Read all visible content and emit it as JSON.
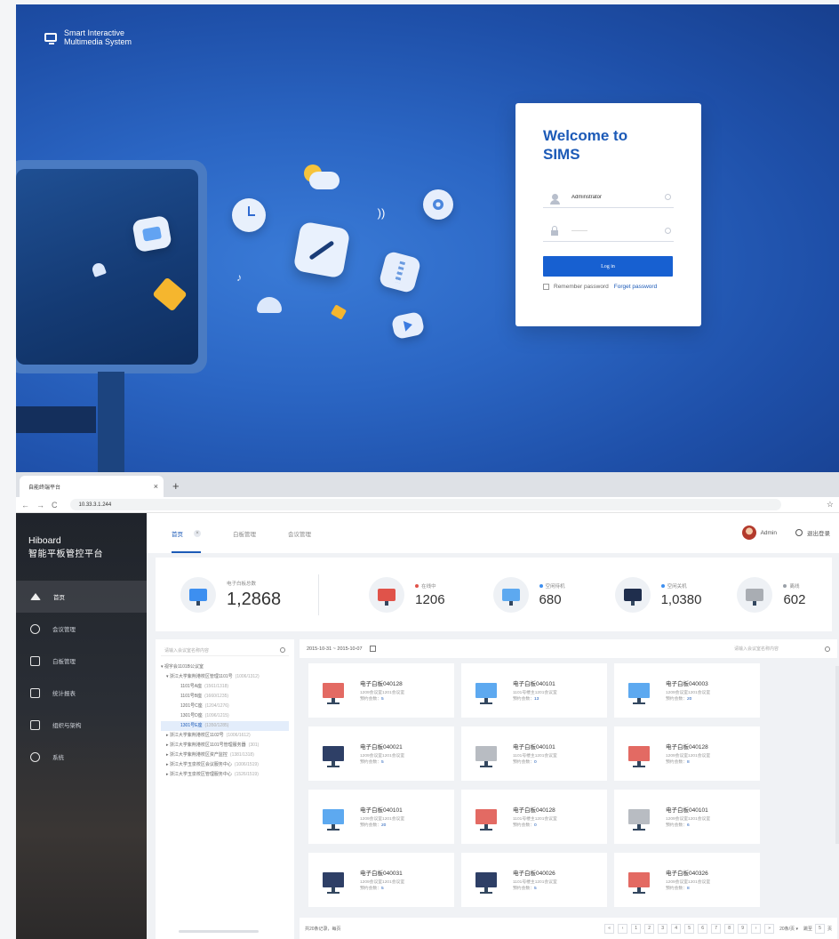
{
  "login": {
    "brand_line1": "Smart Interactive",
    "brand_line2": "Multimedia System",
    "welcome_line1": "Welcome to",
    "welcome_line2": "SIMS",
    "username_value": "Adminstrator",
    "password_value": "·········",
    "login_button": "Log in",
    "remember_label": "Remember password",
    "forget_label": "Forget password",
    "colors": {
      "accent": "#1760d1",
      "title": "#1c5ab7",
      "bg": "#2b66c4"
    }
  },
  "browser": {
    "tab_title": "自能终端平台",
    "tab_close": "×",
    "new_tab": "+",
    "back": "←",
    "forward": "→",
    "reload": "C",
    "url": "10.33.3.1.244",
    "star": "☆"
  },
  "app": {
    "brand_line1": "Hiboard",
    "brand_line2": "智能平板管控平台",
    "nav": [
      {
        "label": "首页",
        "icon": "home-icon"
      },
      {
        "label": "会议管理",
        "icon": "people-icon"
      },
      {
        "label": "白板管理",
        "icon": "monitor-icon"
      },
      {
        "label": "统计报表",
        "icon": "chart-icon"
      },
      {
        "label": "组织与架构",
        "icon": "send-icon"
      },
      {
        "label": "系统",
        "icon": "settings-icon"
      }
    ],
    "top_tabs": [
      {
        "label": "首页",
        "close": "×"
      },
      {
        "label": "白板管理"
      },
      {
        "label": "会议管理"
      }
    ],
    "user_name": "Admin",
    "logout_label": "退出登录",
    "stats": {
      "total_label": "电子白板总数",
      "total_value": "1,2868",
      "items": [
        {
          "label": "在线中",
          "value": "1206",
          "color": "#e0534a"
        },
        {
          "label": "空闲待机",
          "value": "680",
          "color": "#3d8ff0"
        },
        {
          "label": "空闲关机",
          "value": "1,0380",
          "color": "#3d8ff0"
        },
        {
          "label": "离线",
          "value": "602",
          "color": "#9aa0a8"
        }
      ]
    },
    "tree": {
      "search_placeholder": "请输入会议室名称内容",
      "nodes": [
        {
          "text": "▾ 视字会1101B公议室",
          "count": "",
          "level": "l1"
        },
        {
          "text": "▾ 浙江大学紫荆港校区管理1101号",
          "count": "(1006/1312)",
          "level": "l2"
        },
        {
          "text": "1101号A座",
          "count": "(1561/1318)",
          "level": "l3"
        },
        {
          "text": "1101号B座",
          "count": "(1660/1235)",
          "level": "l3"
        },
        {
          "text": "1201号C座",
          "count": "(1204/1276)",
          "level": "l3"
        },
        {
          "text": "1301号D座",
          "count": "(1096/1215)",
          "level": "l3"
        },
        {
          "text": "1301号E座",
          "count": "(1350/1285)",
          "level": "l3"
        },
        {
          "text": "▸ 浙江大学紫荆港校区1102号",
          "count": "(1006/1612)",
          "level": "l2"
        },
        {
          "text": "▸ 浙江大学紫荆港校区1101号管理服务器",
          "count": "(301)",
          "level": "l2"
        },
        {
          "text": "▸ 浙江大学紫荆港校区资产监控",
          "count": "(1381/1318)",
          "level": "l2"
        },
        {
          "text": "▸ 浙江大学玉泉校区会议服务中心",
          "count": "(1006/1519)",
          "level": "l2"
        },
        {
          "text": "▸ 浙江大学玉泉校区管理服务中心",
          "count": "(1526/1519)",
          "level": "l2"
        }
      ]
    },
    "grid": {
      "date_range": "2015-10-31 ~ 2015-10-07",
      "search_placeholder": "请输入会议室名称内容",
      "cards": [
        {
          "name": "电子白板040128",
          "line1": "1209会议室1201会议室",
          "line2": "预约会数：",
          "count": "5",
          "color": "#e36a63"
        },
        {
          "name": "电子白板040101",
          "line1": "1101号楼主1201会议室",
          "line2": "预约会数：",
          "count": "13",
          "color": "#5da9f0"
        },
        {
          "name": "电子白板040003",
          "line1": "1209会议室1201会议室",
          "line2": "预约会数：",
          "count": "20",
          "color": "#5da9f0"
        },
        {
          "name": "电子白板040021",
          "line1": "1209会议室1201会议室",
          "line2": "预约会数：",
          "count": "5",
          "color": "#2e3f66"
        },
        {
          "name": "电子白板040101",
          "line1": "1101号楼主1201会议室",
          "line2": "预约会数：",
          "count": "0",
          "color": "#b8bcc2"
        },
        {
          "name": "电子白板040128",
          "line1": "1209会议室1201会议室",
          "line2": "预约会数：",
          "count": "8",
          "color": "#e36a63"
        },
        {
          "name": "电子白板040101",
          "line1": "1209会议室1201会议室",
          "line2": "预约会数：",
          "count": "20",
          "color": "#5da9f0"
        },
        {
          "name": "电子白板040128",
          "line1": "1101号楼主1201会议室",
          "line2": "预约会数：",
          "count": "0",
          "color": "#e36a63"
        },
        {
          "name": "电子白板040101",
          "line1": "1209会议室1201会议室",
          "line2": "预约会数：",
          "count": "6",
          "color": "#b8bcc2"
        },
        {
          "name": "电子白板040031",
          "line1": "1209会议室1201会议室",
          "line2": "预约会数：",
          "count": "5",
          "color": "#2e3f66"
        },
        {
          "name": "电子白板040026",
          "line1": "1101号楼主1201会议室",
          "line2": "预约会数：",
          "count": "5",
          "color": "#2e3f66"
        },
        {
          "name": "电子白板040326",
          "line1": "1209会议室1201会议室",
          "line2": "预约会数：",
          "count": "8",
          "color": "#e36a63"
        }
      ],
      "footer_left": "共20条记录，每页",
      "pager": [
        "«",
        "‹",
        "1",
        "2",
        "3",
        "4",
        "5",
        "6",
        "7",
        "8",
        "9",
        "›",
        "»"
      ],
      "page_size": "20条/页 ▾",
      "goto_label": "跳至",
      "goto_value": "5",
      "goto_unit": "页"
    }
  }
}
